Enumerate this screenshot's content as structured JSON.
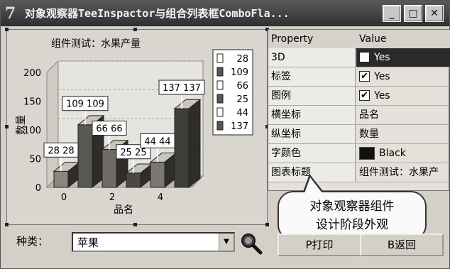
{
  "window": {
    "title": "对象观察器TeeInspactor与组合列表框ComboFla...",
    "app_icon_glyph": "7",
    "controls": {
      "minimize": "_",
      "maximize": "□",
      "close": "✕"
    }
  },
  "chart_data": {
    "type": "bar",
    "title": "组件测试：水果产量",
    "xlabel": "品名",
    "ylabel": "数量",
    "x": [
      0,
      1,
      2,
      3,
      4,
      5
    ],
    "values": [
      28,
      109,
      66,
      25,
      44,
      137
    ],
    "value_labels": [
      "28 28",
      "109 109",
      "66 66",
      "25 25",
      "44 44",
      "137 137"
    ],
    "xticks": [
      "0",
      "2",
      "4"
    ],
    "yticks": [
      "0",
      "50",
      "100",
      "150",
      "200"
    ],
    "ylim": [
      0,
      200
    ],
    "legend": [
      "28",
      "109",
      "66",
      "25",
      "44",
      "137"
    ],
    "legend_placement": "top-right",
    "three_d": true
  },
  "property_grid": {
    "header_property": "Property",
    "header_value": "Value",
    "rows": [
      {
        "name": "3D",
        "value": "Yes",
        "checked": true
      },
      {
        "name": "标签",
        "value": "Yes",
        "checked": true
      },
      {
        "name": "图例",
        "value": "Yes",
        "checked": true
      },
      {
        "name": "横坐标",
        "value": "品名"
      },
      {
        "name": "纵坐标",
        "value": "数量"
      },
      {
        "name": "字颜色",
        "value": "Black",
        "color": "#111111"
      },
      {
        "name": "图表标题",
        "value": "组件测试：水果产"
      }
    ]
  },
  "callout": {
    "line1": "对象观察器组件",
    "line2": "设计阶段外观"
  },
  "bottom": {
    "category_label": "种类：",
    "combo_value": "苹果",
    "print_button": "P打印",
    "back_button": "B返回"
  }
}
